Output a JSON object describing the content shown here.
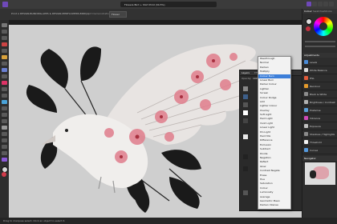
{
  "app": {
    "window_title": "Flowers Bird + Shirt Print (34.5%)",
    "document_tab": "Print A DESIGN-BLINDING-APPS & DESIGN-PIERFLOWERS-BIRD(A)",
    "tab_extra": "Art Demonstration 5 - 8",
    "tab_label_box": "Flower",
    "personas": [
      "P",
      "L",
      "E",
      "X",
      "S"
    ]
  },
  "right_panel": {
    "tabs": [
      "Colour",
      "Swatches",
      "Stroke",
      "Brushes"
    ],
    "adjustments_tabs": [
      "Adjustments",
      "Effects",
      "Styles",
      "Stock"
    ],
    "adjustments": [
      {
        "label": "Levels",
        "color": "#4b8bd6"
      },
      {
        "label": "White Balance",
        "color": "#d9d9d9"
      },
      {
        "label": "HSL",
        "color": "#e05a3a"
      },
      {
        "label": "Recolour",
        "color": "#e39a2c"
      },
      {
        "label": "Black & White",
        "color": "#8c8c8c"
      },
      {
        "label": "Brightness / Contrast",
        "color": "#b0b0b0"
      },
      {
        "label": "Posterise",
        "color": "#5b9fd8"
      },
      {
        "label": "Vibrance",
        "color": "#d04ab8"
      },
      {
        "label": "Exposure",
        "color": "#c0c0c0"
      },
      {
        "label": "Shadows / Highlights",
        "color": "#8a8a8a"
      },
      {
        "label": "Threshold",
        "color": "#f2f2f2"
      },
      {
        "label": "Curves",
        "color": "#5599dd"
      },
      {
        "label": "Channel Mixer",
        "color": "#5fbf5f"
      }
    ],
    "navigator_tabs": [
      "Navigator",
      "Transform",
      "History"
    ]
  },
  "layers_panel": {
    "tabs": [
      "Layers",
      "Effects",
      "Styles"
    ],
    "opacity_label": "Opacity:",
    "opacity": "100%",
    "blend_mode": "Normal"
  },
  "blend_menu": {
    "items": [
      "Passthrough",
      "Normal",
      "Darken",
      "Multiply",
      "Colour Burn",
      "Linear Burn",
      "Darker Colour",
      "Lighten",
      "Screen",
      "Colour Dodge",
      "Add",
      "Lighter Colour",
      "Overlay",
      "Soft Light",
      "Hard Light",
      "Vivid Light",
      "Linear Light",
      "Pin Light",
      "Hard Mix",
      "Difference",
      "Exclusion",
      "Subtract",
      "Divide",
      "Negation",
      "Reflect",
      "Glow",
      "Contrast Negate",
      "Erase",
      "Hue",
      "Saturation",
      "Colour",
      "Luminosity",
      "Average",
      "Geometric Mean",
      "Darken Intense"
    ],
    "selected_index": 4
  },
  "status": {
    "text": "Drag to marquee select. Click an object to select it."
  },
  "colors": {
    "chrome": "#2d2d2d",
    "canvas": "#cfcfcf",
    "accent": "#3d7fd9",
    "pink": "#e07d8c"
  }
}
